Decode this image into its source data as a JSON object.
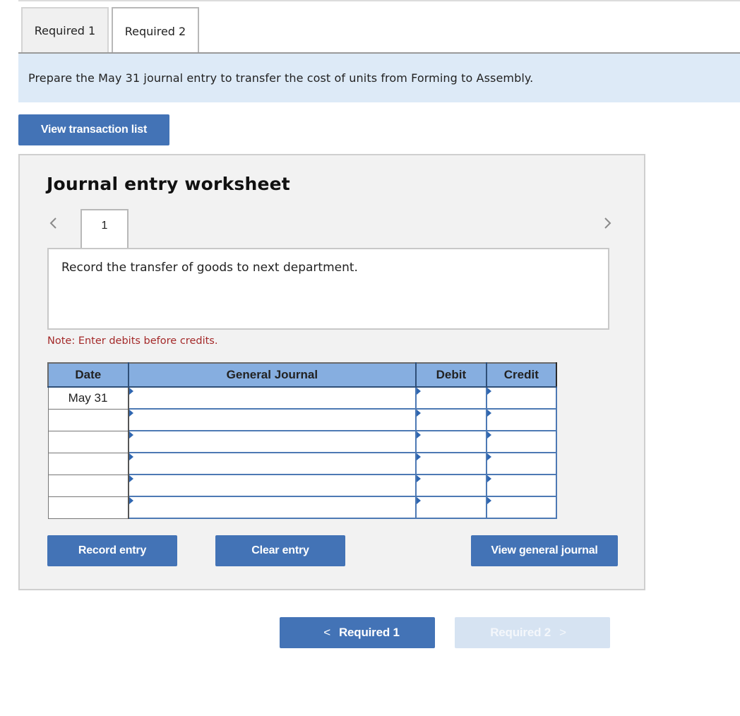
{
  "tabs": [
    {
      "label": "Required 1",
      "active": false
    },
    {
      "label": "Required 2",
      "active": true
    }
  ],
  "instruction": "Prepare the May 31 journal entry to transfer the cost of units from Forming to Assembly.",
  "view_transactions_label": "View transaction list",
  "worksheet": {
    "title": "Journal entry worksheet",
    "entry_number": "1",
    "description": "Record the transfer of goods to next department.",
    "note": "Note: Enter debits before credits.",
    "table": {
      "headers": {
        "date": "Date",
        "general_journal": "General Journal",
        "debit": "Debit",
        "credit": "Credit"
      },
      "rows": [
        {
          "date": "May 31",
          "account": "",
          "debit": "",
          "credit": ""
        },
        {
          "date": "",
          "account": "",
          "debit": "",
          "credit": ""
        },
        {
          "date": "",
          "account": "",
          "debit": "",
          "credit": ""
        },
        {
          "date": "",
          "account": "",
          "debit": "",
          "credit": ""
        },
        {
          "date": "",
          "account": "",
          "debit": "",
          "credit": ""
        },
        {
          "date": "",
          "account": "",
          "debit": "",
          "credit": ""
        }
      ]
    },
    "buttons": {
      "record": "Record entry",
      "clear": "Clear entry",
      "view_general_journal": "View general journal"
    }
  },
  "nav": {
    "prev_label": "Required 1",
    "next_label": "Required 2",
    "next_disabled": true
  },
  "icons": {
    "prev": "chevron-left-icon",
    "next": "chevron-right-icon",
    "cell_marker": "triangle-right-icon"
  },
  "colors": {
    "accent": "#4373b6",
    "header_bg": "#86aee0",
    "instruction_bg": "#ddeaf7",
    "note": "#a42a2a",
    "disabled": "#d6e3f2"
  }
}
